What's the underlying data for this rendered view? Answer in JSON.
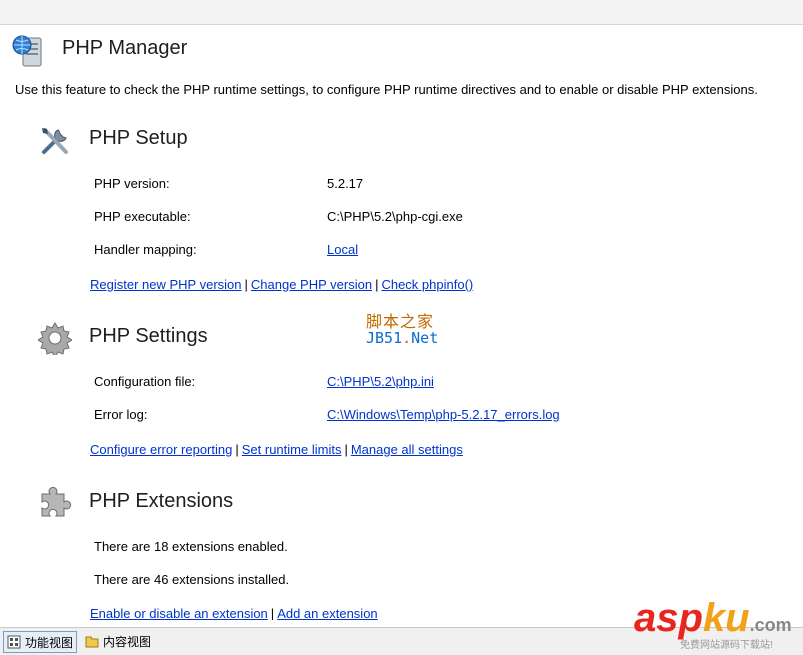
{
  "header": {
    "title": "PHP Manager",
    "description": "Use this feature to check the PHP runtime settings, to configure PHP runtime directives and to enable or disable PHP extensions."
  },
  "setup": {
    "title": "PHP Setup",
    "rows": [
      {
        "label": "PHP version:",
        "value": "5.2.17"
      },
      {
        "label": "PHP executable:",
        "value": "C:\\PHP\\5.2\\php-cgi.exe"
      },
      {
        "label": "Handler mapping:",
        "value": "Local"
      }
    ],
    "actions": [
      "Register new PHP version",
      "Change PHP version",
      "Check phpinfo()"
    ]
  },
  "settings": {
    "title": "PHP Settings",
    "rows": [
      {
        "label": "Configuration file:",
        "value": "C:\\PHP\\5.2\\php.ini"
      },
      {
        "label": "Error log:",
        "value": "C:\\Windows\\Temp\\php-5.2.17_errors.log"
      }
    ],
    "actions": [
      "Configure error reporting",
      "Set runtime limits",
      "Manage all settings"
    ]
  },
  "extensions": {
    "title": "PHP Extensions",
    "lines": [
      "There are 18 extensions enabled.",
      "There are 46 extensions installed."
    ],
    "actions": [
      "Enable or disable an extension",
      "Add an extension"
    ]
  },
  "watermark": {
    "line1": "脚本之家",
    "line2a": "JB51",
    "line2b": ".",
    "line2c": "Net",
    "brand_a": "asp",
    "brand_b": "ku",
    "brand_c": ".com",
    "brand_sub": "免费网站源码下载站!"
  },
  "bottom_bar": {
    "tabs": [
      "功能视图",
      "内容视图"
    ]
  },
  "icons": {
    "header": "server-globe-icon",
    "setup": "tools-icon",
    "settings": "gear-icon",
    "extensions": "puzzle-icon"
  }
}
